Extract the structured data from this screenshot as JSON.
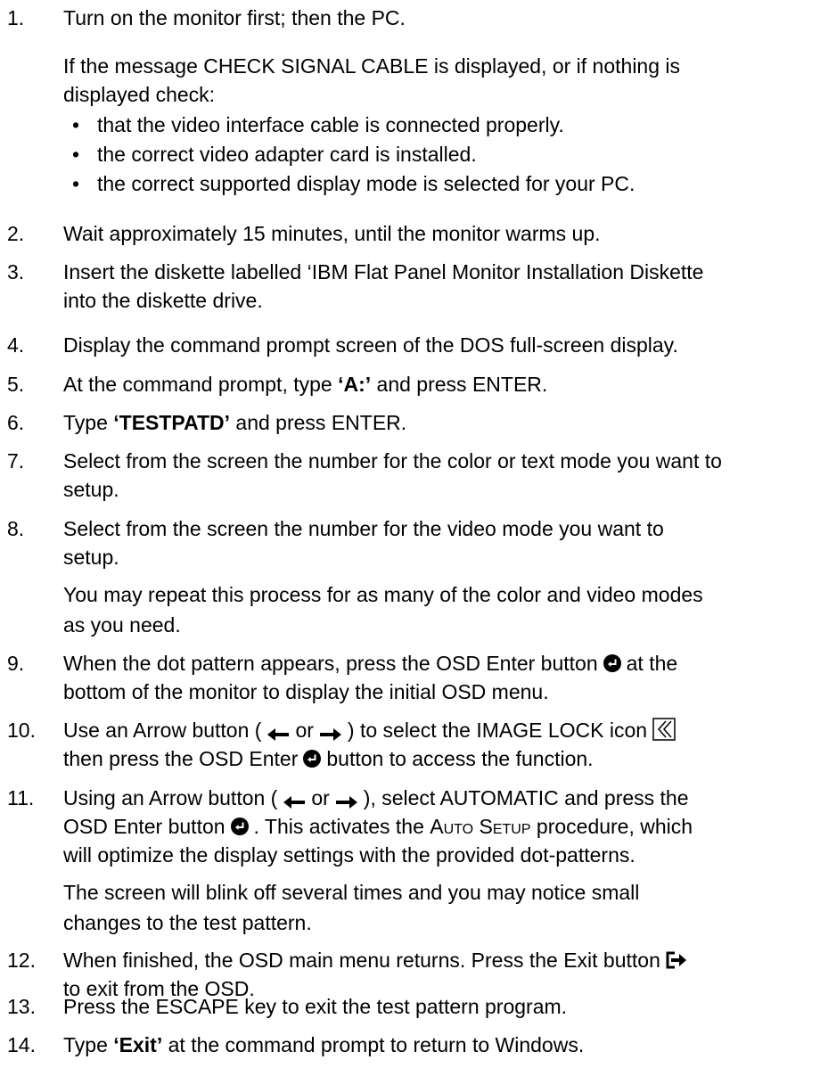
{
  "steps": [
    {
      "num": "1.",
      "text": "Turn on the monitor first; then the PC."
    },
    {
      "para1": "If the message CHECK SIGNAL CABLE is displayed, or if nothing is",
      "para2": "displayed check:",
      "bullets": [
        "that the video interface cable is connected properly.",
        "the correct video adapter card is installed.",
        "the correct supported display mode is selected for your PC."
      ]
    },
    {
      "num": "2.",
      "text": "Wait approximately 15 minutes, until the monitor warms up."
    },
    {
      "num": "3.",
      "line1": "Insert the diskette labelled ‘IBM Flat Panel Monitor Installation Diskette",
      "line2": "into the diskette drive."
    },
    {
      "num": "4.",
      "text": "Display the command prompt screen of the DOS full-screen display."
    },
    {
      "num": "5.",
      "pre": "At the command prompt, type ",
      "bold": "‘A:’",
      "post": " and press ENTER."
    },
    {
      "num": "6.",
      "pre": "Type ",
      "bold": "‘TESTPATD’",
      "post": " and press ENTER."
    },
    {
      "num": "7.",
      "line1": "Select from the screen the number for the color or text mode you want to",
      "line2": "setup."
    },
    {
      "num": "8.",
      "line1": "Select from the screen the number for the video mode you want to",
      "line2": "setup.",
      "para1": "You may repeat this process for as many of the color and video modes",
      "para2": "as you need."
    },
    {
      "num": "9.",
      "pre": "When the dot pattern appears, press the OSD Enter button",
      "post": "at the",
      "line2": "bottom of the monitor to display the initial OSD menu."
    },
    {
      "num": "10.",
      "pre": "Use an Arrow button (",
      "or": "or",
      "post": ") to select the IMAGE LOCK icon",
      "l2pre": "then press the OSD Enter",
      "l2post": "button to access the function."
    },
    {
      "num": "11.",
      "pre": "Using an Arrow button (",
      "or": "or",
      "post": "), select AUTOMATIC and press the",
      "l2pre": "OSD Enter button",
      "l2mid": ". This activates the ",
      "l2sc": "Auto Setup",
      "l2post": " procedure, which",
      "line3": "will optimize the display settings with the provided dot-patterns.",
      "para1": "The screen will blink off several times and you may notice small",
      "para2": "changes to the test pattern."
    },
    {
      "num": "12.",
      "pre": "When finished, the OSD main menu returns. Press the Exit button",
      "line2": "to exit from the OSD."
    },
    {
      "num": "13.",
      "text": "Press the ESCAPE key to exit the test pattern program."
    },
    {
      "num": "14.",
      "pre": "Type ",
      "bold": "‘Exit’",
      "post": " at the command prompt to return to Windows."
    }
  ],
  "icons": {
    "enter": "enter-button-icon",
    "exit": "exit-button-icon",
    "image_lock": "image-lock-icon",
    "arrow_left": "left-arrow-icon",
    "arrow_right": "right-arrow-icon"
  }
}
